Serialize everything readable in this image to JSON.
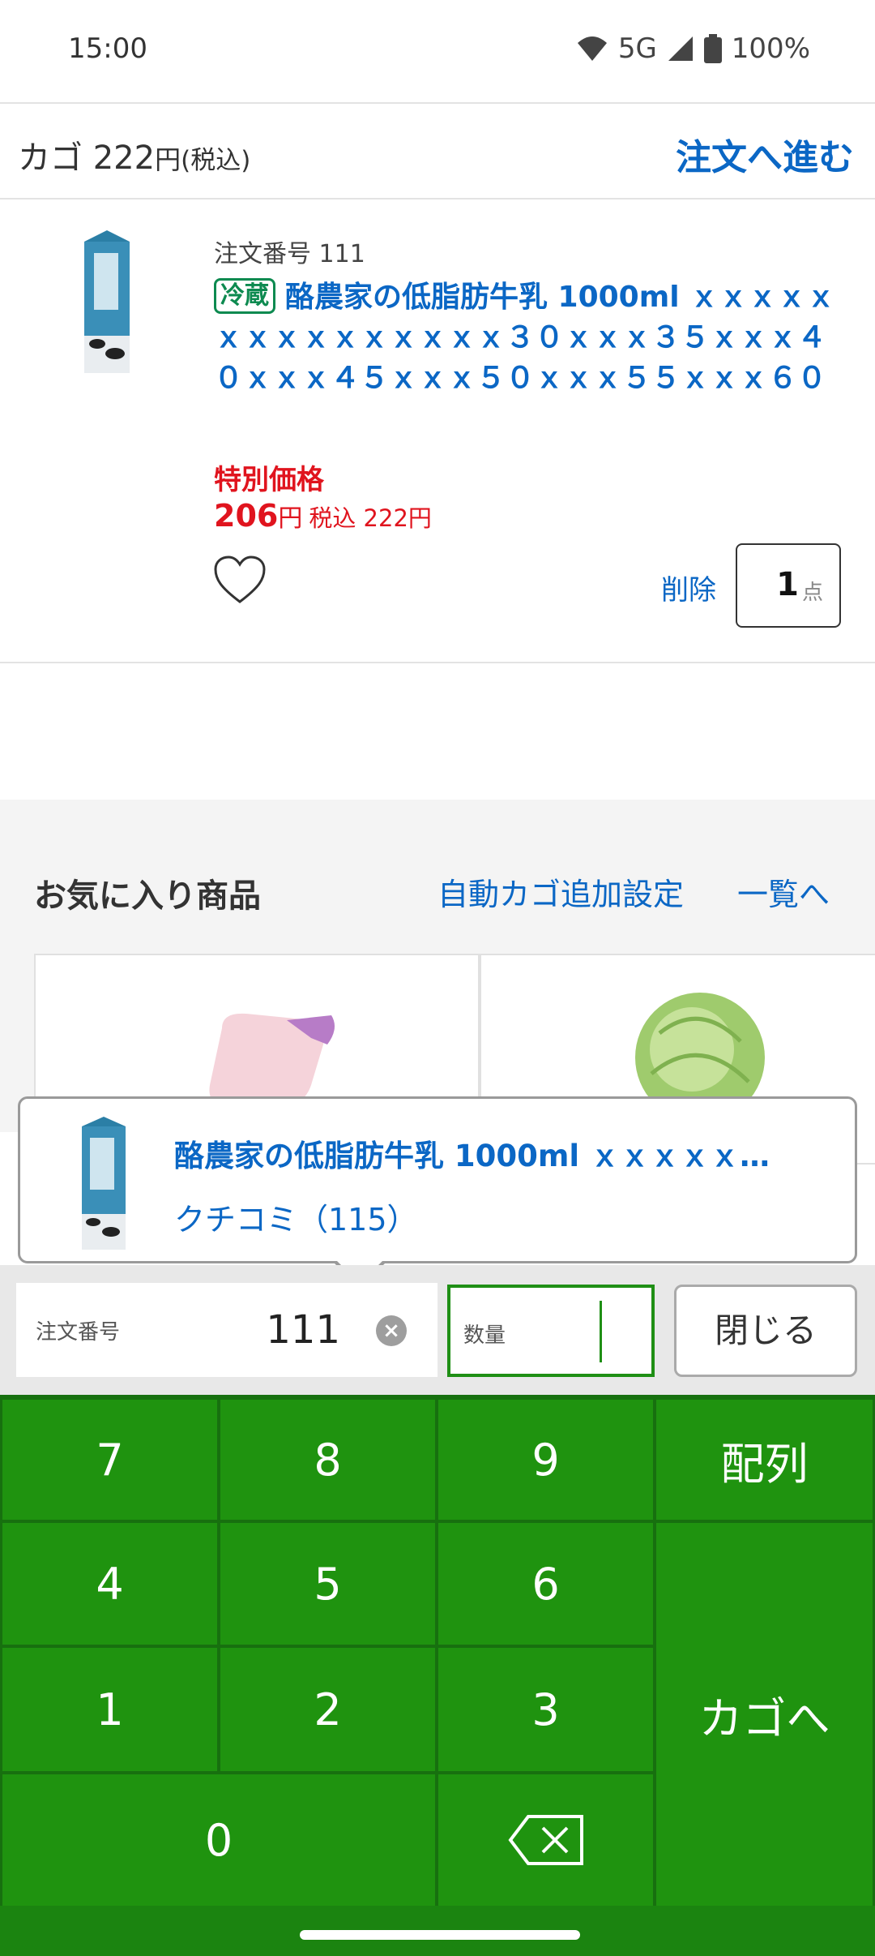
{
  "status_bar": {
    "time": "15:00",
    "network": "5G",
    "battery": "100%"
  },
  "cart_header": {
    "label": "カゴ",
    "amount": "222",
    "yen": "円",
    "tax": "(税込)",
    "order_button": "注文へ進む"
  },
  "product": {
    "order_no_label": "注文番号",
    "order_no": "111",
    "badge": "冷蔵",
    "name": "酪農家の低脂肪牛乳 1000ml ｘｘｘｘｘｘｘｘｘｘｘｘｘｘｘ３０ｘｘｘ３５ｘｘｘ４０ｘｘｘ４５ｘｘｘ５０ｘｘｘ５５ｘｘｘ６０",
    "special_label": "特別価格",
    "price": "206",
    "price_yen": "円",
    "price_tax": "税込 222円",
    "delete_label": "削除",
    "quantity": "1",
    "quantity_unit": "点"
  },
  "favorites": {
    "title": "お気に入り商品",
    "auto_add": "自動カゴ追加設定",
    "list_link": "一覧へ"
  },
  "popup": {
    "name": "酪農家の低脂肪牛乳 1000ml ｘｘｘｘｘ…",
    "review": "クチコミ（115）"
  },
  "input_bar": {
    "order_field_label": "注文番号",
    "order_field_value": "111",
    "qty_field_label": "数量",
    "close_label": "閉じる"
  },
  "keypad": {
    "k7": "7",
    "k8": "8",
    "k9": "9",
    "array": "配列",
    "k4": "4",
    "k5": "5",
    "k6": "6",
    "k1": "1",
    "k2": "2",
    "k3": "3",
    "to_cart": "カゴへ",
    "k0": "0"
  },
  "colors": {
    "link_blue": "#0b67c5",
    "price_red": "#e0141e",
    "keypad_green": "#1f930f",
    "keypad_grid": "#17700f",
    "cold_green": "#0d8a50"
  }
}
